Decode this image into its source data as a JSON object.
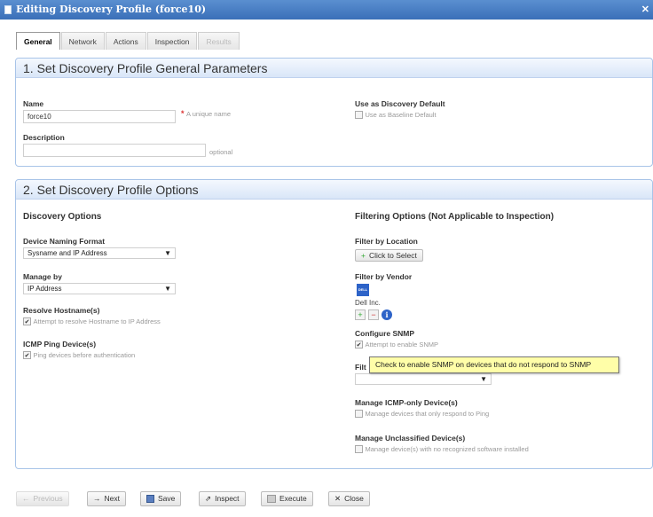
{
  "window": {
    "title": "Editing Discovery Profile (force10)"
  },
  "tabs": [
    {
      "label": "General"
    },
    {
      "label": "Network"
    },
    {
      "label": "Actions"
    },
    {
      "label": "Inspection"
    },
    {
      "label": "Results"
    }
  ],
  "section1": {
    "title": "1. Set Discovery Profile General Parameters",
    "name_label": "Name",
    "name_value": "force10",
    "name_hint": "A unique name",
    "description_label": "Description",
    "description_value": "",
    "description_hint": "optional",
    "default_label": "Use as Discovery Default",
    "default_checkbox_label": "Use as Baseline Default"
  },
  "section2": {
    "title": "2. Set Discovery Profile Options",
    "discovery_options_heading": "Discovery Options",
    "naming_label": "Device Naming Format",
    "naming_value": "Sysname and IP Address",
    "manage_by_label": "Manage by",
    "manage_by_value": "IP Address",
    "resolve_label": "Resolve Hostname(s)",
    "resolve_checkbox": "Attempt to resolve Hostname to IP Address",
    "icmp_label": "ICMP Ping Device(s)",
    "icmp_checkbox": "Ping devices before authentication",
    "filtering_heading": "Filtering Options (Not Applicable to Inspection)",
    "location_label": "Filter by Location",
    "location_button": "Click to Select",
    "vendor_label": "Filter by Vendor",
    "vendor_name": "Dell Inc.",
    "vendor_logo_text": "DELL",
    "snmp_label": "Configure SNMP",
    "snmp_checkbox": "Attempt to enable SNMP",
    "filter_partial_label": "Filt",
    "filter_select_value": "",
    "icmp_only_label": "Manage ICMP-only Device(s)",
    "icmp_only_checkbox": "Manage devices that only respond to Ping",
    "unclassified_label": "Manage Unclassified Device(s)",
    "unclassified_checkbox": "Manage device(s) with no recognized software installed"
  },
  "tooltip": {
    "text": "Check to enable SNMP on devices that do not respond to SNMP"
  },
  "buttons": {
    "previous": "Previous",
    "next": "Next",
    "save": "Save",
    "inspect": "Inspect",
    "execute": "Execute",
    "close": "Close"
  },
  "colors": {
    "titlebar": "#3a6fb8",
    "section_border": "#a8c4e8",
    "tooltip_bg": "#fffea8",
    "accent_blue": "#2d63c8"
  }
}
